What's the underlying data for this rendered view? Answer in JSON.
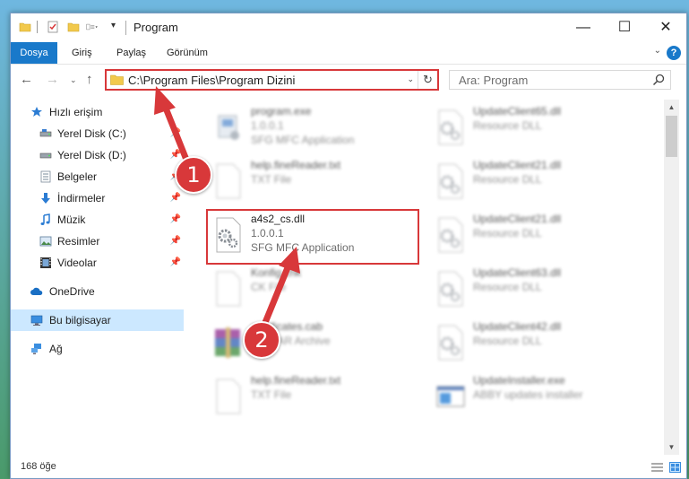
{
  "window": {
    "title": "Program",
    "controls": {
      "minimize": "—",
      "maximize": "☐",
      "close": "✕"
    }
  },
  "quick_access_toolbar": {
    "dropdown": "▾"
  },
  "ribbon": {
    "tabs": [
      "Dosya",
      "Giriş",
      "Paylaş",
      "Görünüm"
    ],
    "expand": "⌄",
    "help": "?"
  },
  "navigation": {
    "back": "←",
    "forward": "→",
    "recent": "⌄",
    "up": "↑"
  },
  "address_bar": {
    "path": "C:\\Program Files\\Program Dizini",
    "dropdown": "⌄",
    "refresh": "↻"
  },
  "search": {
    "placeholder": "Ara: Program"
  },
  "sidebar": {
    "items": [
      {
        "label": "Hızlı erişim",
        "icon": "star-icon",
        "pinned": false
      },
      {
        "label": "Yerel Disk (C:)",
        "icon": "drive-icon",
        "pinned": true
      },
      {
        "label": "Yerel Disk (D:)",
        "icon": "drive-icon",
        "pinned": true
      },
      {
        "label": "Belgeler",
        "icon": "documents-icon",
        "pinned": true
      },
      {
        "label": "İndirmeler",
        "icon": "download-icon",
        "pinned": true
      },
      {
        "label": "Müzik",
        "icon": "music-icon",
        "pinned": true
      },
      {
        "label": "Resimler",
        "icon": "pictures-icon",
        "pinned": true
      },
      {
        "label": "Videolar",
        "icon": "video-icon",
        "pinned": true
      },
      {
        "label": "OneDrive",
        "icon": "cloud-icon",
        "pinned": false
      },
      {
        "label": "Bu bilgisayar",
        "icon": "computer-icon",
        "pinned": false,
        "selected": true
      },
      {
        "label": "Ağ",
        "icon": "network-icon",
        "pinned": false
      }
    ],
    "pin_glyph": "📌"
  },
  "files": {
    "left": [
      {
        "name": "program.exe",
        "line2": "1.0.0.1",
        "line3": "SFG MFC Application",
        "icon": "installer-icon"
      },
      {
        "name": "help.fineReader.txt",
        "line2": "TXT File",
        "line3": "",
        "icon": "text-file-icon"
      },
      {
        "name": "a4s2_cs.dll",
        "line2": "1.0.0.1",
        "line3": "SFG MFC Application",
        "icon": "dll-gear-icon",
        "highlighted": true
      },
      {
        "name": "Konfig.chk",
        "line2": "CK File",
        "line3": "",
        "icon": "text-file-icon"
      },
      {
        "name": "certificates.cab",
        "line2": "WinRAR Archive",
        "line3": "",
        "icon": "winrar-icon"
      },
      {
        "name": "help.fineReader.txt",
        "line2": "TXT File",
        "line3": "",
        "icon": "text-file-icon"
      }
    ],
    "right": [
      {
        "name": "UpdateClient65.dll",
        "line2": "Resource DLL",
        "icon": "dll-gear-icon"
      },
      {
        "name": "UpdateClient21.dll",
        "line2": "Resource DLL",
        "icon": "dll-gear-icon"
      },
      {
        "name": "UpdateClient21.dll",
        "line2": "Resource DLL",
        "icon": "dll-gear-icon"
      },
      {
        "name": "UpdateClient63.dll",
        "line2": "Resource DLL",
        "icon": "dll-gear-icon"
      },
      {
        "name": "UpdateClient42.dll",
        "line2": "Resource DLL",
        "icon": "dll-gear-icon"
      },
      {
        "name": "UpdateInstaller.exe",
        "line2": "ABBY updates installer",
        "icon": "app-window-icon"
      }
    ]
  },
  "scrollbar": {
    "up": "▲",
    "down": "▼"
  },
  "status": {
    "count": "168 öğe"
  },
  "annotations": {
    "step1": "1",
    "step2": "2",
    "accent": "#d8383a"
  }
}
